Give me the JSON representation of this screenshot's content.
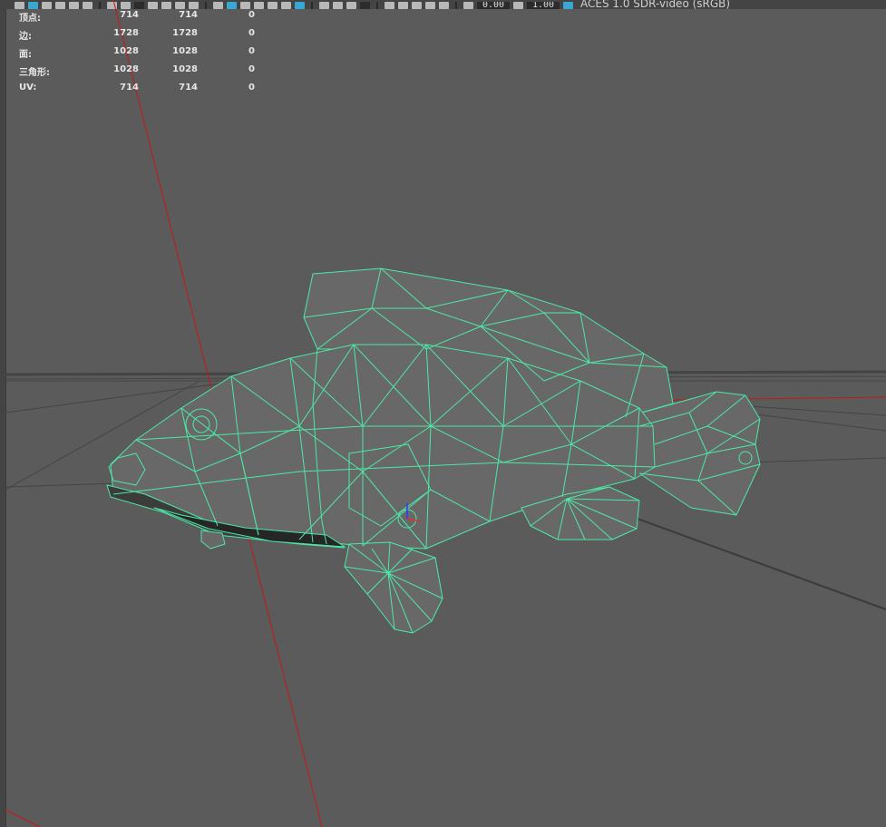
{
  "toolbar": {
    "exposure_value": "0.00",
    "gamma_value": "1.00",
    "color_space_label": "ACES 1.0 SDR-video (sRGB)"
  },
  "stats": [
    {
      "label": "顶点:",
      "v1": "714",
      "v2": "714",
      "v3": "0"
    },
    {
      "label": "边:",
      "v1": "1728",
      "v2": "1728",
      "v3": "0"
    },
    {
      "label": "面:",
      "v1": "1028",
      "v2": "1028",
      "v3": "0"
    },
    {
      "label": "三角形:",
      "v1": "1028",
      "v2": "1028",
      "v3": "0"
    },
    {
      "label": "UV:",
      "v1": "714",
      "v2": "714",
      "v3": "0"
    }
  ],
  "colors": {
    "viewport_bg": "#5b5b5b",
    "wireframe": "#4de8a6",
    "mesh_fill": "#696969",
    "x_axis": "#c41818",
    "grid": "#444444"
  }
}
